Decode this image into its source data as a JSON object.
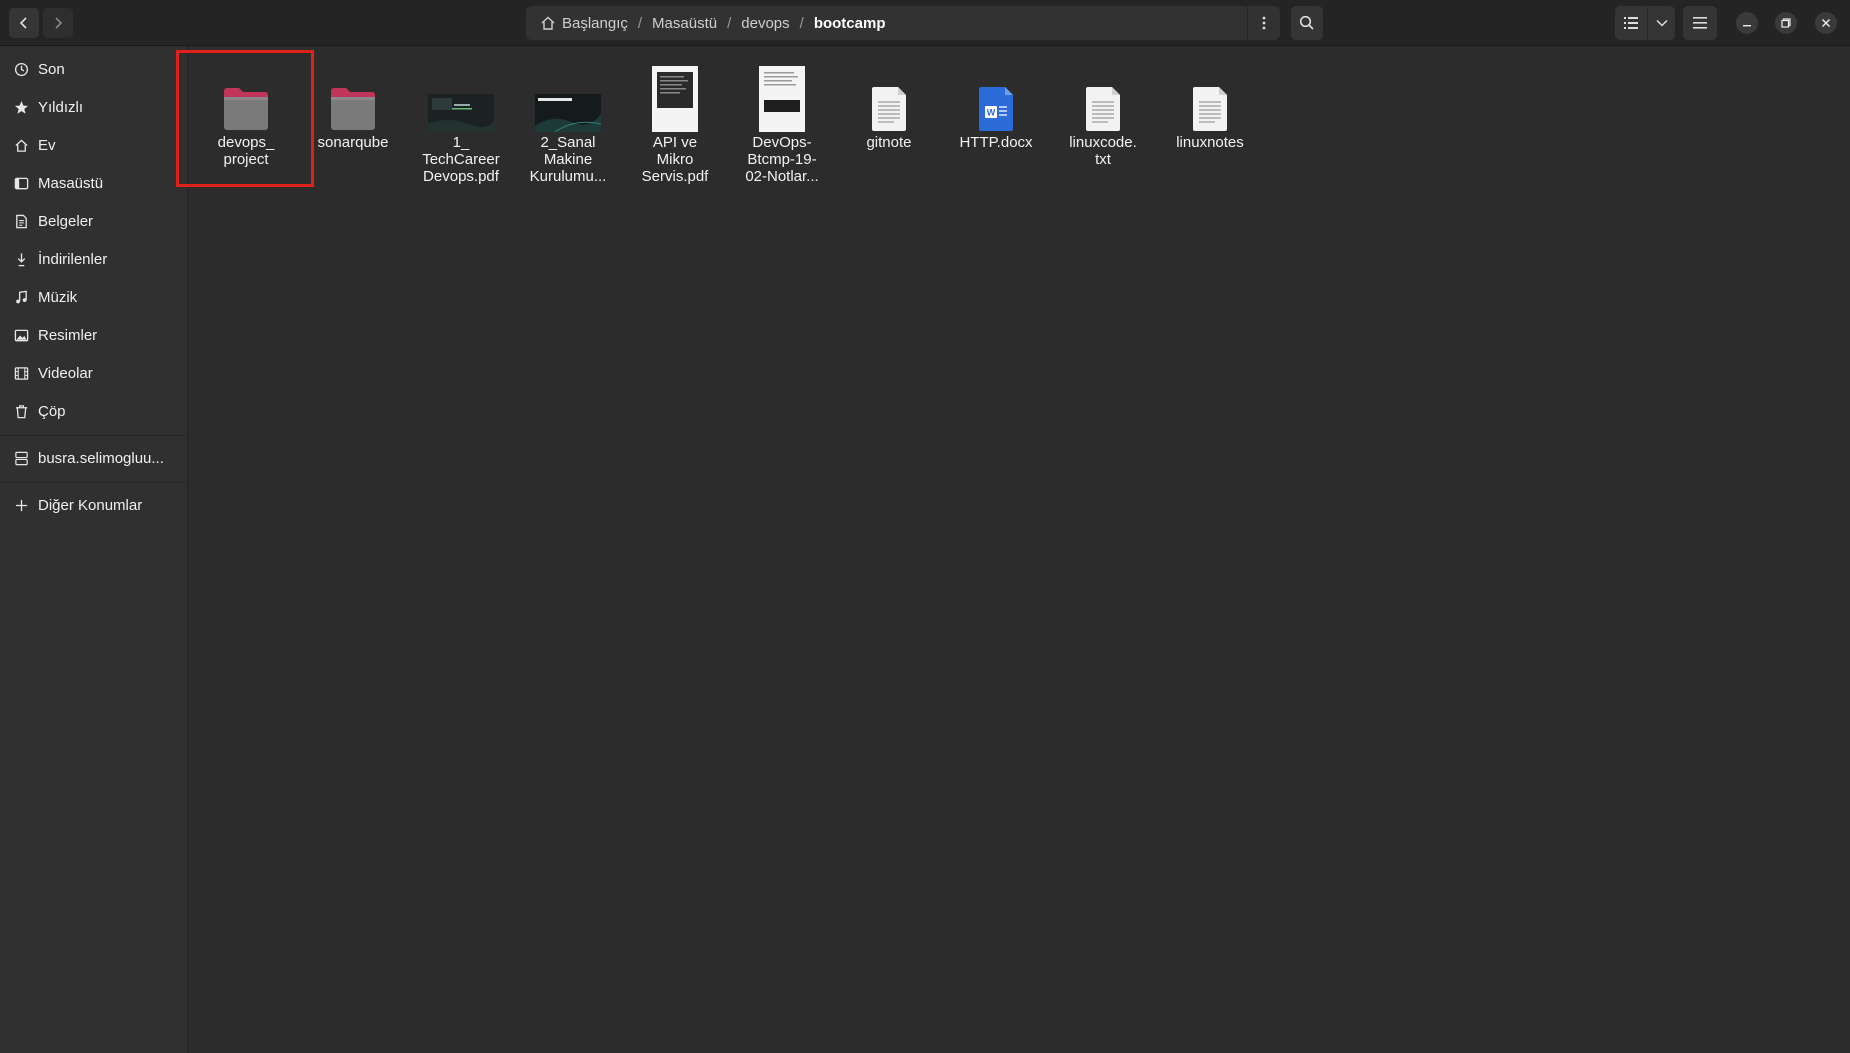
{
  "pathbar": {
    "crumbs": [
      "Başlangıç",
      "Masaüstü",
      "devops",
      "bootcamp"
    ]
  },
  "icons": {
    "back": "chevron-left-icon",
    "forward": "chevron-right-icon",
    "home": "home-icon",
    "path_menu": "vertical-dots-icon",
    "search": "search-icon",
    "view_list": "list-view-icon",
    "view_dropdown": "chevron-down-icon",
    "main_menu": "hamburger-menu-icon",
    "minimize": "minimize-icon",
    "maximize": "maximize-icon",
    "close": "close-icon"
  },
  "sidebar": {
    "items": [
      {
        "label": "Son",
        "icon": "clock-icon"
      },
      {
        "label": "Yıldızlı",
        "icon": "star-icon"
      },
      {
        "label": "Ev",
        "icon": "home-icon"
      },
      {
        "label": "Masaüstü",
        "icon": "desktop-icon"
      },
      {
        "label": "Belgeler",
        "icon": "document-icon"
      },
      {
        "label": "İndirilenler",
        "icon": "download-icon"
      },
      {
        "label": "Müzik",
        "icon": "music-icon"
      },
      {
        "label": "Resimler",
        "icon": "image-icon"
      },
      {
        "label": "Videolar",
        "icon": "film-icon"
      },
      {
        "label": "Çöp",
        "icon": "trash-icon"
      },
      {
        "label": "busra.selimogluu...",
        "icon": "drive-icon"
      },
      {
        "label": "Diğer Konumlar",
        "icon": "plus-icon"
      }
    ]
  },
  "files": [
    {
      "name": "devops_\nproject",
      "type": "folder"
    },
    {
      "name": "sonarqube",
      "type": "folder"
    },
    {
      "name": "1_\nTechCareer\nDevops.pdf",
      "type": "pdf-dark-slide"
    },
    {
      "name": "2_Sanal\nMakine\nKurulumu...",
      "type": "pdf-dark-slide",
      "thumb_text": "SANAL MAKINE"
    },
    {
      "name": "API ve\nMikro\nServis.pdf",
      "type": "pdf-page-dark"
    },
    {
      "name": "DevOps-\nBtcmp-19-\n02-Notlar...",
      "type": "pdf-page-light"
    },
    {
      "name": "gitnote",
      "type": "text"
    },
    {
      "name": "HTTP.docx",
      "type": "word"
    },
    {
      "name": "linuxcode.\ntxt",
      "type": "text"
    },
    {
      "name": "linuxnotes",
      "type": "text"
    }
  ],
  "colors": {
    "background": "#2c2c2c",
    "sidebar": "#303030",
    "headerbar": "#242424",
    "folder_tab": "#c0355a",
    "folder_body": "#7a7a7a",
    "highlight": "#e0201b",
    "word_blue": "#2b6cd8"
  }
}
